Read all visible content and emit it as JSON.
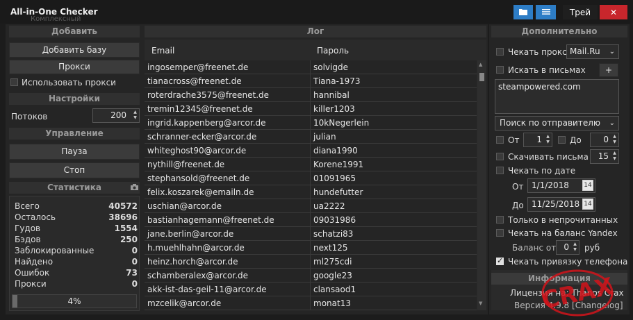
{
  "window": {
    "title": "All-in-One Checker",
    "ghost_subtitle": "Комплексный",
    "tray_label": "Трей",
    "close_label": "✕"
  },
  "left": {
    "add_header": "Добавить",
    "add_base_button": "Добавить базу",
    "proxy_button": "Прокси",
    "use_proxy_label": "Использовать прокси",
    "settings_header": "Настройки",
    "threads_label": "Потоков",
    "threads_value": "200",
    "control_header": "Управление",
    "pause_button": "Пауза",
    "stop_button": "Стоп",
    "stats_header": "Статистика",
    "stats": [
      {
        "k": "Всего",
        "v": "40572"
      },
      {
        "k": "Осталось",
        "v": "38696"
      },
      {
        "k": "Гудов",
        "v": "1554"
      },
      {
        "k": "Бэдов",
        "v": "250"
      },
      {
        "k": "Заблокированные",
        "v": "0"
      },
      {
        "k": "Найдено",
        "v": "0"
      },
      {
        "k": "Ошибок",
        "v": "73"
      },
      {
        "k": "Прокси",
        "v": "0"
      }
    ],
    "progress_text": "4%",
    "progress_fraction": 0.04
  },
  "log": {
    "header": "Лог",
    "col_email": "Email",
    "col_password": "Пароль",
    "rows": [
      [
        "ingosemper@freenet.de",
        "solvigde"
      ],
      [
        "tianacross@freenet.de",
        "Tiana-1973"
      ],
      [
        "roterdrache3575@freenet.de",
        "hannibal"
      ],
      [
        "tremin12345@freenet.de",
        "killer1203"
      ],
      [
        "ingrid.kappenberg@arcor.de",
        "10kNegerlein"
      ],
      [
        "schranner-ecker@arcor.de",
        "julian"
      ],
      [
        "whiteghost90@arcor.de",
        "diana1990"
      ],
      [
        "nythill@freenet.de",
        "Korene1991"
      ],
      [
        "stephansold@freenet.de",
        "01091965"
      ],
      [
        "felix.koszarek@emailn.de",
        "hundefutter"
      ],
      [
        "uschian@arcor.de",
        "ua2222"
      ],
      [
        "bastianhagemann@freenet.de",
        "09031986"
      ],
      [
        "jane.berlin@arcor.de",
        "schatzi83"
      ],
      [
        "h.muehlhahn@arcor.de",
        "next125"
      ],
      [
        "heinz.horch@arcor.de",
        "ml275cdi"
      ],
      [
        "schamberalex@arcor.de",
        "google23"
      ],
      [
        "akk-ist-das-geil-11@arcor.de",
        "clansaod1"
      ],
      [
        "mzcelik@arcor.de",
        "monat13"
      ]
    ]
  },
  "right": {
    "header": "Дополнительно",
    "check_proxy_label": "Чекать прокси",
    "provider_value": "Mail.Ru",
    "search_in_mail_label": "Искать в письмах",
    "plus_button": "+",
    "search_text": "steampowered.com",
    "search_mode": "Поиск по отправителю",
    "from_label": "От",
    "from_value": "1",
    "to_label": "До",
    "to_value": "0",
    "download_label": "Скачивать письма",
    "download_value": "15",
    "check_by_date_label": "Чекать по дате",
    "date_from_label": "От",
    "date_from": "1/1/2018",
    "date_to_label": "До",
    "date_to": "11/25/2018",
    "unread_only_label": "Только в непрочитанных",
    "check_yandex_label": "Чекать на баланс Yandex",
    "balance_label": "Баланс от",
    "balance_value": "0",
    "balance_unit": "руб",
    "check_phone_label": "Чекать привязку телефона",
    "info_header": "Информация",
    "license_text": "Лицензия на: Thanos Crax",
    "version_text": "Версия 4.9.8 [Changelog]",
    "watermark_text": "CRAX"
  },
  "colors": {
    "accent": "#2d7dc6",
    "close": "#c8262c",
    "watermark": "#d4141b"
  }
}
